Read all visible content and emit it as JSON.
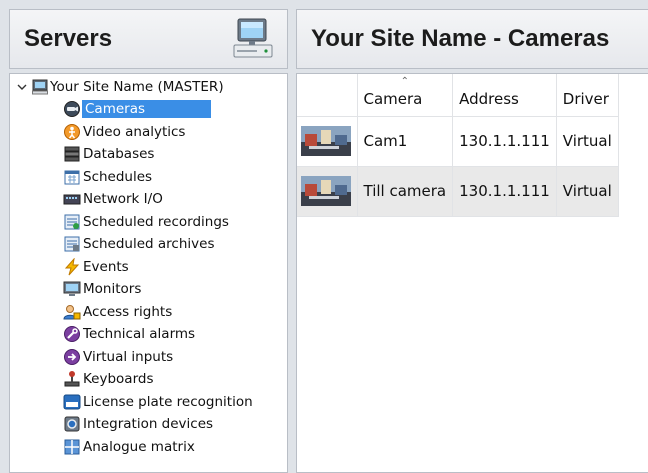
{
  "servers_panel": {
    "title": "Servers",
    "icon": "server-computer-icon"
  },
  "main_panel": {
    "title": "Your Site Name - Cameras"
  },
  "tree": {
    "root": {
      "label": "Your Site Name (MASTER)",
      "expanded": true,
      "icon": "site-server-icon"
    },
    "items": [
      {
        "label": "Cameras",
        "icon": "camera-icon",
        "selected": true
      },
      {
        "label": "Video analytics",
        "icon": "video-analytics-icon"
      },
      {
        "label": "Databases",
        "icon": "database-icon"
      },
      {
        "label": "Schedules",
        "icon": "schedule-icon"
      },
      {
        "label": "Network I/O",
        "icon": "network-io-icon"
      },
      {
        "label": "Scheduled recordings",
        "icon": "scheduled-recording-icon"
      },
      {
        "label": "Scheduled archives",
        "icon": "scheduled-archive-icon"
      },
      {
        "label": "Events",
        "icon": "lightning-icon"
      },
      {
        "label": "Monitors",
        "icon": "monitor-icon"
      },
      {
        "label": "Access rights",
        "icon": "access-rights-icon"
      },
      {
        "label": "Technical alarms",
        "icon": "wrench-icon"
      },
      {
        "label": "Virtual inputs",
        "icon": "virtual-input-icon"
      },
      {
        "label": "Keyboards",
        "icon": "joystick-icon"
      },
      {
        "label": "License plate recognition",
        "icon": "license-plate-icon"
      },
      {
        "label": "Integration devices",
        "icon": "integration-device-icon"
      },
      {
        "label": "Analogue matrix",
        "icon": "analogue-matrix-icon"
      }
    ]
  },
  "cameras_table": {
    "sorted_column": "Camera",
    "columns": [
      {
        "label": "Camera"
      },
      {
        "label": "Address"
      },
      {
        "label": "Driver"
      }
    ],
    "rows": [
      {
        "camera": "Cam1",
        "address": "130.1.1.111",
        "driver": "Virtual",
        "thumbnail_icon": "camera-thumbnail-icon"
      },
      {
        "camera": "Till camera",
        "address": "130.1.1.111",
        "driver": "Virtual",
        "thumbnail_icon": "camera-thumbnail-icon"
      }
    ]
  }
}
